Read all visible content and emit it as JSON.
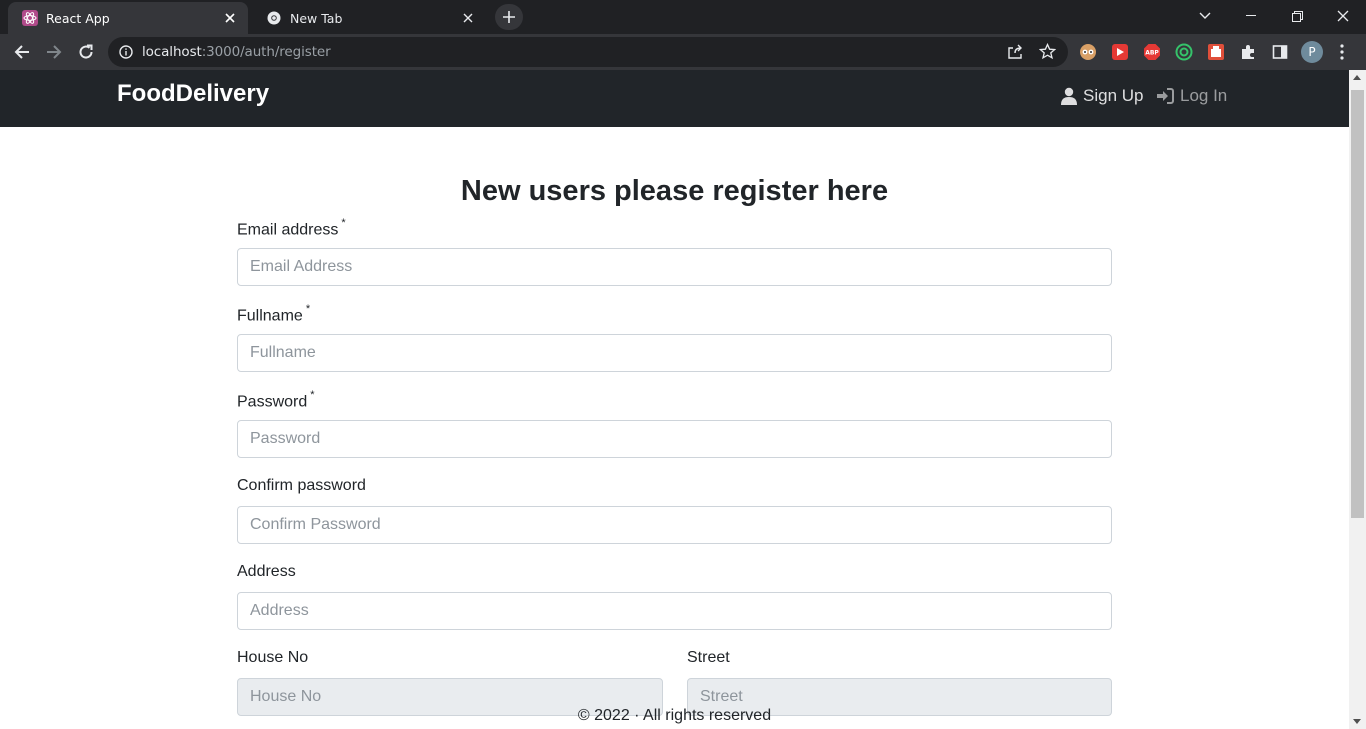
{
  "browser": {
    "tabs": [
      {
        "title": "React App",
        "active": true
      },
      {
        "title": "New Tab",
        "active": false
      }
    ],
    "url_host": "localhost",
    "url_path": ":3000/auth/register",
    "profile_initial": "P",
    "extensions": [
      "incognito-like-icon",
      "video-icon",
      "abp-icon",
      "target-icon",
      "capture-icon",
      "puzzle-icon"
    ]
  },
  "navbar": {
    "brand": "FoodDelivery",
    "signup_label": "Sign Up",
    "login_label": "Log In"
  },
  "form": {
    "title": "New users please register here",
    "required_mark": "*",
    "email": {
      "label": "Email address",
      "placeholder": "Email Address",
      "value": ""
    },
    "fullname": {
      "label": "Fullname",
      "placeholder": "Fullname",
      "value": ""
    },
    "password": {
      "label": "Password",
      "placeholder": "Password",
      "value": ""
    },
    "confirm_password": {
      "label": "Confirm password",
      "placeholder": "Confirm Password",
      "value": ""
    },
    "address": {
      "label": "Address",
      "placeholder": "Address",
      "value": ""
    },
    "house_no": {
      "label": "House No",
      "placeholder": "House No",
      "value": ""
    },
    "street": {
      "label": "Street",
      "placeholder": "Street",
      "value": ""
    }
  },
  "footer": {
    "text": "© 2022 · All rights reserved"
  },
  "colors": {
    "navbar": "#212529",
    "chrome_dark": "#202124",
    "chrome_toolbar": "#35363a",
    "disabled_field": "#e9ecef"
  }
}
